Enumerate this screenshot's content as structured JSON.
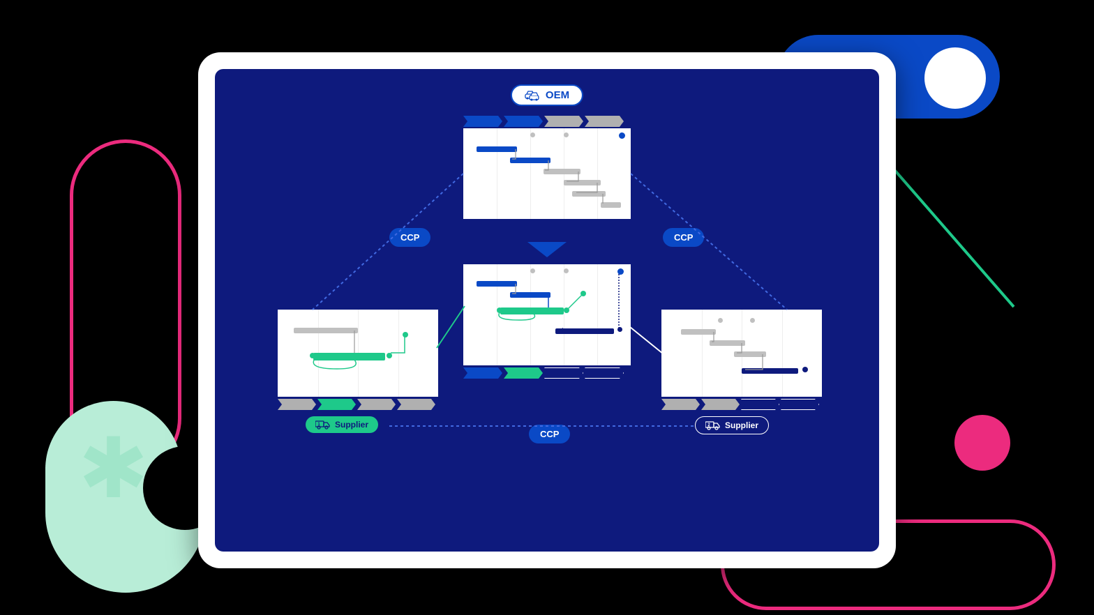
{
  "oem_label": "OEM",
  "ccp_label_left": "CCP",
  "ccp_label_right": "CCP",
  "ccp_label_bottom": "CCP",
  "supplier_1_label": "Supplier",
  "supplier_1_num": "1",
  "supplier_2_label": "Supplier",
  "supplier_2_num": "2",
  "colors": {
    "navy": "#0E1A7D",
    "blue": "#0A49C6",
    "green": "#1EC98A",
    "mint": "#B8EDD7",
    "pink": "#EC2B7E",
    "gray": "#B0B0B0"
  }
}
